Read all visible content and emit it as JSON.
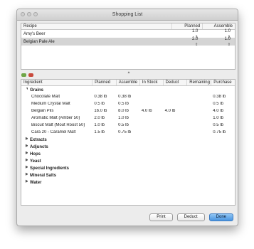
{
  "window": {
    "title": "Shopping List"
  },
  "recipes": {
    "headers": {
      "recipe": "Recipe",
      "planned": "Planned",
      "assemble": "Assemble"
    },
    "rows": [
      {
        "name": "Amy's Beer",
        "planned": "1.0",
        "assemble": "1.0",
        "selected": false
      },
      {
        "name": "Belgian Pale Ale",
        "planned": "2.0",
        "assemble": "1.0",
        "selected": true
      }
    ]
  },
  "ingredients": {
    "headers": {
      "ingredient": "Ingredient",
      "planned": "Planned",
      "assemble": "Assemble",
      "in_stock": "In Stock",
      "deduct": "Deduct",
      "remaining": "Remaining",
      "purchase": "Purchase"
    },
    "grains": {
      "label": "Grains",
      "items": [
        {
          "name": "Chocolate Malt",
          "planned": "0.38 lb",
          "assemble": "0.38 lb",
          "in_stock": "",
          "deduct": "",
          "remaining": "",
          "purchase": "0.38 lb"
        },
        {
          "name": "Medium Crystal Malt",
          "planned": "0.5 lb",
          "assemble": "0.5 lb",
          "in_stock": "",
          "deduct": "",
          "remaining": "",
          "purchase": "0.5 lb"
        },
        {
          "name": "Belgian Pils",
          "planned": "16.0 lb",
          "assemble": "8.0 lb",
          "in_stock": "4.0 lb",
          "deduct": "4.0 lb",
          "remaining": "",
          "purchase": "4.0 lb"
        },
        {
          "name": "Aromatic Malt (Amber 50)",
          "planned": "2.0 lb",
          "assemble": "1.0 lb",
          "in_stock": "",
          "deduct": "",
          "remaining": "",
          "purchase": "1.0 lb"
        },
        {
          "name": "Biscuit Malt (Mout Roost 50)",
          "planned": "1.0 lb",
          "assemble": "0.5 lb",
          "in_stock": "",
          "deduct": "",
          "remaining": "",
          "purchase": "0.5 lb"
        },
        {
          "name": "Cara 20 - Caramel Malt",
          "planned": "1.5 lb",
          "assemble": "0.75 lb",
          "in_stock": "",
          "deduct": "",
          "remaining": "",
          "purchase": "0.75 lb"
        }
      ]
    },
    "groups": [
      "Extracts",
      "Adjuncts",
      "Hops",
      "Yeast",
      "Special Ingredients",
      "Mineral Salts",
      "Water"
    ]
  },
  "buttons": {
    "print": "Print",
    "deduct": "Deduct",
    "done": "Done"
  },
  "icons": {
    "collapsed": "▶",
    "expanded": "▼",
    "stepper": "⇕",
    "splitter": "▲"
  }
}
